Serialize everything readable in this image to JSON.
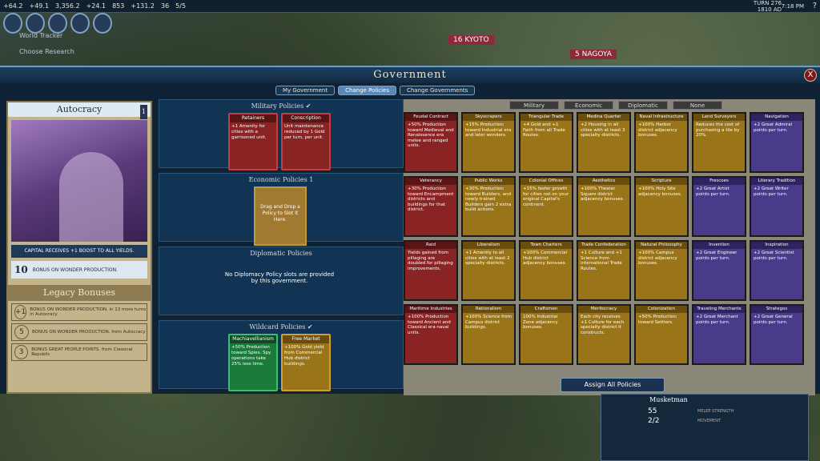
{
  "topbar": {
    "science": "+64.2",
    "culture": "+49.1",
    "faith": "3,356.2",
    "faith_rate": "+24.1",
    "gold": "853",
    "gold_rate": "+131.2",
    "tourism": "36",
    "trade": "5/5",
    "turn": "TURN 276",
    "year": "1810 AD",
    "clock": "7:18 PM",
    "help": "?"
  },
  "map": {
    "city1": "KYOTO",
    "city1_pop": "16",
    "city2": "NAGOYA",
    "city2_pop": "5",
    "note1": "World Tracker",
    "note2": "Choose Research"
  },
  "gov": {
    "title": "Government",
    "close": "X"
  },
  "tabs": [
    {
      "label": "My Government"
    },
    {
      "label": "Change Policies"
    },
    {
      "label": "Change Governments"
    }
  ],
  "govt": {
    "name": "Autocracy",
    "slot": "1",
    "bonus1": "CAPITAL RECEIVES +1 BOOST TO ALL YIELDS.",
    "bonus2_num": "10",
    "bonus2_text": "BONUS ON WONDER PRODUCTION."
  },
  "legacy": {
    "title": "Legacy Bonuses",
    "items": [
      {
        "num": "+1",
        "text": "BONUS ON WONDER PRODUCTION. in 13 more turns in Autocracy"
      },
      {
        "num": "5",
        "text": "BONUS ON WONDER PRODUCTION. from Autocracy"
      },
      {
        "num": "3",
        "text": "BONUS GREAT PEOPLE POINTS. from Classical Republic"
      }
    ]
  },
  "sections": {
    "military": "Military Policies ✔",
    "economic": "Economic Policies 1",
    "diplomatic": "Diplomatic Policies",
    "wildcard": "Wildcard Policies ✔",
    "diplomatic_empty": "No Diplomacy Policy slots are provided by this government.",
    "drag": "Drag and Drop a Policy to Slot it Here."
  },
  "slotted": {
    "retainers": {
      "title": "Retainers",
      "text": "+1 Amenity for cities with a garrisoned unit."
    },
    "conscription": {
      "title": "Conscription",
      "text": "Unit maintenance reduced by 1 Gold per turn, per unit."
    },
    "machiavellianism": {
      "title": "Machiavellianism",
      "text": "+50% Production toward Spies. Spy operations take 25% less time."
    },
    "freemarket": {
      "title": "Free Market",
      "text": "+100% Gold yield from Commercial Hub district buildings."
    }
  },
  "filters": [
    {
      "label": "Military"
    },
    {
      "label": "Economic"
    },
    {
      "label": "Diplomatic"
    },
    {
      "label": "None"
    }
  ],
  "policies": [
    {
      "title": "Feudal Contract",
      "text": "+50% Production toward Medieval and Renaissance era melee and ranged units.",
      "cls": "mil"
    },
    {
      "title": "Skyscrapers",
      "text": "+15% Production toward Industrial era and later wonders.",
      "cls": "eco"
    },
    {
      "title": "Triangular Trade",
      "text": "+4 Gold and +1 Faith from all Trade Routes.",
      "cls": "eco"
    },
    {
      "title": "Medina Quarter",
      "text": "+2 Housing in all cities with at least 3 specialty districts.",
      "cls": "eco"
    },
    {
      "title": "Naval Infrastructure",
      "text": "+100% Harbor district adjacency bonuses.",
      "cls": "eco"
    },
    {
      "title": "Land Surveyors",
      "text": "Reduces the cost of purchasing a tile by 20%.",
      "cls": "eco"
    },
    {
      "title": "Navigation",
      "text": "+2 Great Admiral points per turn.",
      "cls": "dip"
    },
    {
      "title": "Veterancy",
      "text": "+30% Production toward Encampment districts and buildings for that district.",
      "cls": "mil"
    },
    {
      "title": "Public Works",
      "text": "+30% Production toward Builders, and newly trained Builders gain 2 extra build actions.",
      "cls": "eco"
    },
    {
      "title": "Colonial Offices",
      "text": "+15% faster growth for cities not on your original Capital's continent.",
      "cls": "eco"
    },
    {
      "title": "Aesthetics",
      "text": "+100% Theater Square district adjacency bonuses.",
      "cls": "eco"
    },
    {
      "title": "Scripture",
      "text": "+100% Holy Site adjacency bonuses.",
      "cls": "eco"
    },
    {
      "title": "Frescoes",
      "text": "+2 Great Artist points per turn.",
      "cls": "dip"
    },
    {
      "title": "Literary Tradition",
      "text": "+2 Great Writer points per turn.",
      "cls": "dip"
    },
    {
      "title": "Raid",
      "text": "Yields gained from pillaging are doubled for pillaging improvements.",
      "cls": "mil"
    },
    {
      "title": "Liberalism",
      "text": "+1 Amenity to all cities with at least 2 specialty districts.",
      "cls": "eco"
    },
    {
      "title": "Town Charters",
      "text": "+100% Commercial Hub district adjacency bonuses.",
      "cls": "eco"
    },
    {
      "title": "Trade Confederation",
      "text": "+1 Culture and +1 Science from international Trade Routes.",
      "cls": "eco"
    },
    {
      "title": "Natural Philosophy",
      "text": "+100% Campus district adjacency bonuses.",
      "cls": "eco"
    },
    {
      "title": "Invention",
      "text": "+2 Great Engineer points per turn.",
      "cls": "dip"
    },
    {
      "title": "Inspiration",
      "text": "+2 Great Scientist points per turn.",
      "cls": "dip"
    },
    {
      "title": "Maritime Industries",
      "text": "+100% Production toward Ancient and Classical era naval units.",
      "cls": "mil"
    },
    {
      "title": "Rationalism",
      "text": "+100% Science from Campus district buildings.",
      "cls": "eco"
    },
    {
      "title": "Craftsmen",
      "text": "100% Industrial Zone adjacency bonuses.",
      "cls": "eco"
    },
    {
      "title": "Meritocracy",
      "text": "Each city receives +1 Culture for each specialty district it constructs.",
      "cls": "eco"
    },
    {
      "title": "Colonization",
      "text": "+50% Production toward Settlers.",
      "cls": "eco"
    },
    {
      "title": "Traveling Merchants",
      "text": "+2 Great Merchant points per turn.",
      "cls": "dip"
    },
    {
      "title": "Strategos",
      "text": "+2 Great General points per turn.",
      "cls": "dip"
    }
  ],
  "assign": "Assign All Policies",
  "unit": {
    "name": "Musketman",
    "melee": "MELEE STRENGTH",
    "movement": "MOVEMENT",
    "strength": "55",
    "moves": "2/2"
  }
}
